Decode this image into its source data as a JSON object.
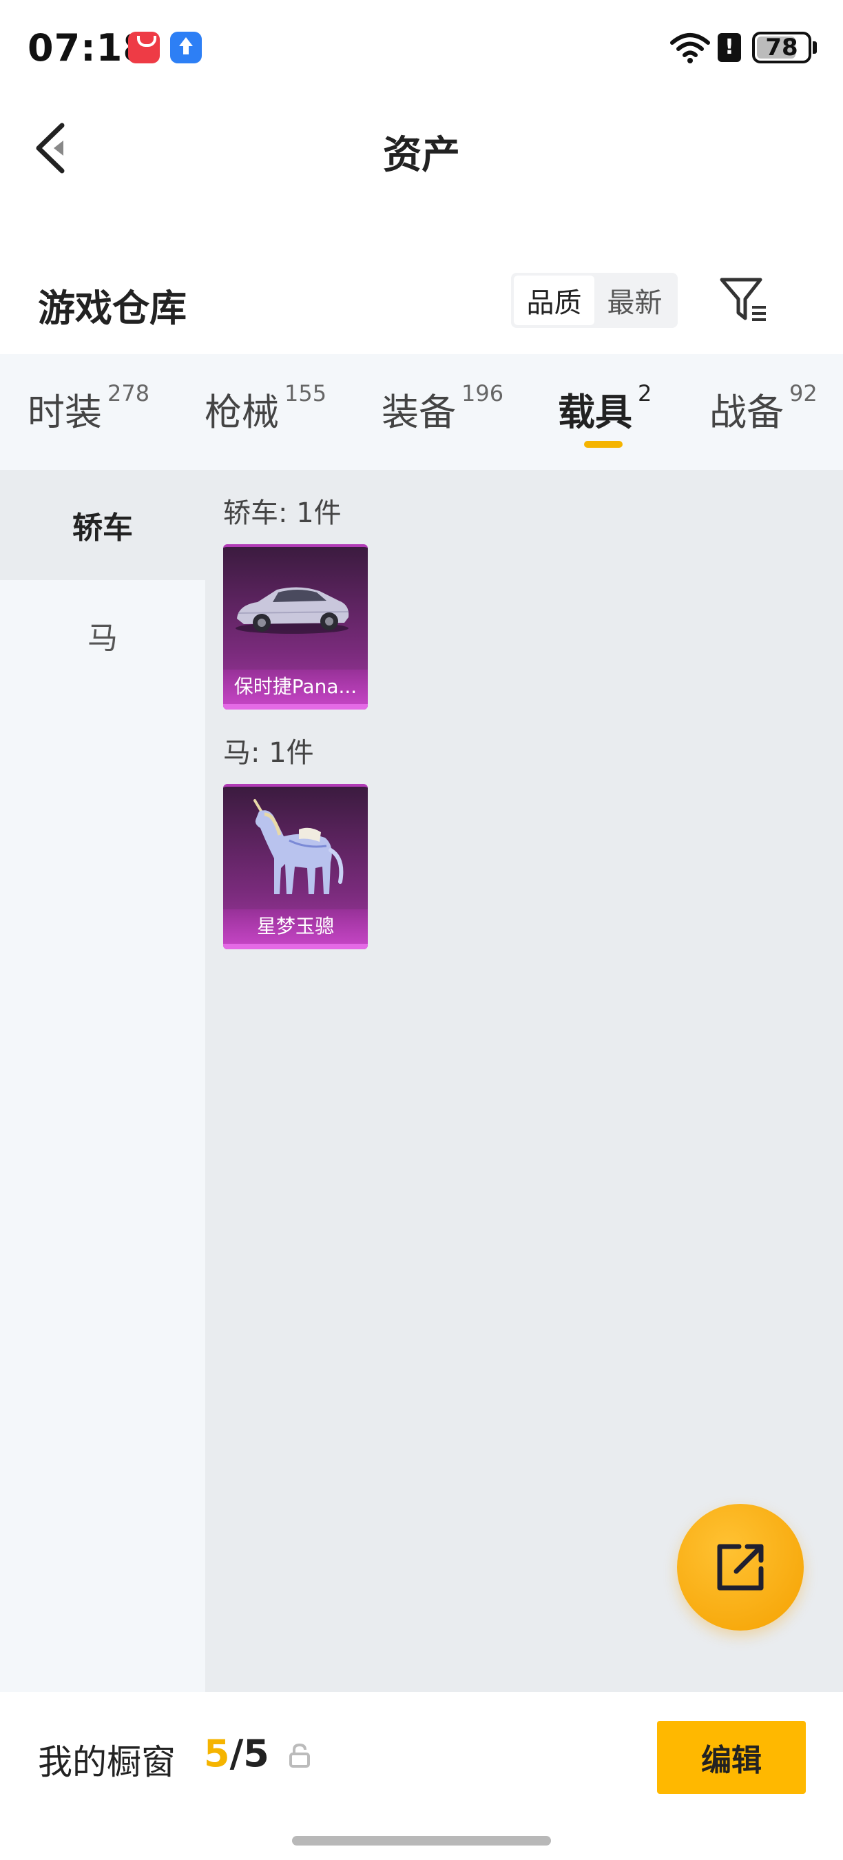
{
  "status_bar": {
    "time": "07:18",
    "battery": "78",
    "battery_level": 0.78,
    "icons": [
      "app-gallery-icon",
      "upload-icon",
      "wifi-icon",
      "alert-icon",
      "battery-icon"
    ]
  },
  "header": {
    "title": "资产",
    "back_icon": "chevron-left-icon"
  },
  "warehouse": {
    "title": "游戏仓库",
    "sort_options": [
      {
        "label": "品质",
        "selected": true
      },
      {
        "label": "最新",
        "selected": false
      }
    ],
    "filter_icon": "filter-icon"
  },
  "tabs": [
    {
      "label": "时装",
      "count": "278",
      "active": false
    },
    {
      "label": "枪械",
      "count": "155",
      "active": false
    },
    {
      "label": "装备",
      "count": "196",
      "active": false
    },
    {
      "label": "载具",
      "count": "2",
      "active": true
    },
    {
      "label": "战备",
      "count": "92",
      "active": false
    }
  ],
  "colors": {
    "accent": "#f5b400",
    "card_purple": "#7a2b7c",
    "panel_bg": "#f4f7fa",
    "content_bg": "#e9ecef"
  },
  "side_categories": [
    {
      "label": "轿车",
      "active": true
    },
    {
      "label": "马",
      "active": false
    }
  ],
  "groups": [
    {
      "label": "轿车: 1件",
      "items": [
        {
          "name": "保时捷Pana...",
          "art": "car-image"
        }
      ]
    },
    {
      "label": "马: 1件",
      "items": [
        {
          "name": "星梦玉骢",
          "art": "unicorn-image"
        }
      ]
    }
  ],
  "fab": {
    "icon": "share-icon"
  },
  "bottom_bar": {
    "label": "我的橱窗",
    "count_current": "5",
    "count_total": "/5",
    "lock_icon": "lock-icon",
    "edit_label": "编辑"
  }
}
